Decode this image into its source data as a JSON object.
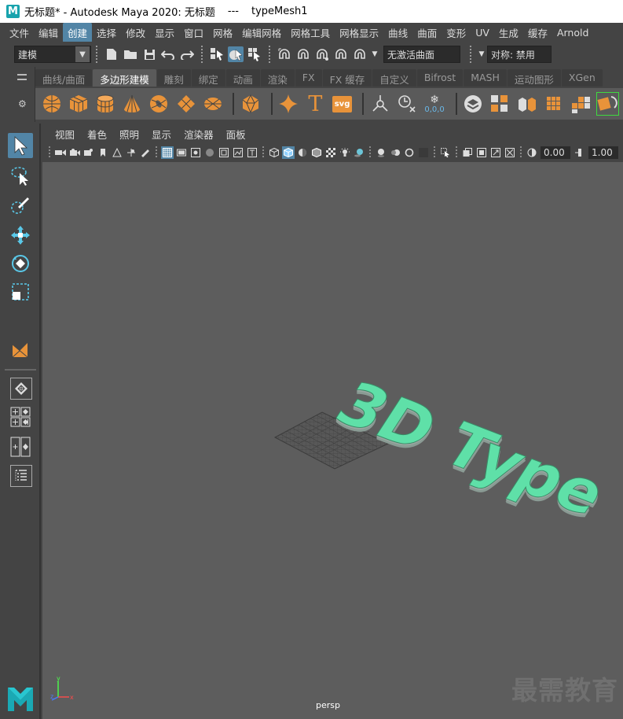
{
  "window": {
    "title": "无标题* - Autodesk Maya 2020: 无标题",
    "separator": "---",
    "object": "typeMesh1"
  },
  "menubar": {
    "items": [
      "文件",
      "编辑",
      "创建",
      "选择",
      "修改",
      "显示",
      "窗口",
      "网格",
      "编辑网格",
      "网格工具",
      "网格显示",
      "曲线",
      "曲面",
      "变形",
      "UV",
      "生成",
      "缓存",
      "Arnold"
    ],
    "active_index": 2
  },
  "statusline": {
    "menuset": "建模",
    "live_surface": "无激活曲面",
    "symmetry": "对称: 禁用"
  },
  "shelf": {
    "tabs": [
      "曲线/曲面",
      "多边形建模",
      "雕刻",
      "绑定",
      "动画",
      "渲染",
      "FX",
      "FX 缓存",
      "自定义",
      "Bifrost",
      "MASH",
      "运动图形",
      "XGen"
    ],
    "active_index": 1,
    "svg_label": "svg",
    "text_tool_label": "T",
    "snap_label": "0,0,0"
  },
  "panel": {
    "menus": [
      "视图",
      "着色",
      "照明",
      "显示",
      "渲染器",
      "面板"
    ],
    "exposure": "0.00",
    "gamma": "1.00"
  },
  "viewport": {
    "camera": "persp",
    "text_3d": "3D Type",
    "text_color": "#5fe0a8",
    "axis_y": "y",
    "axis_z": "z",
    "axis_x": "x"
  },
  "watermark": "最需教育",
  "colors": {
    "highlight": "#5285a6",
    "shelf_icon": "#e8933a",
    "viewport_bg": "#5d5d5d"
  }
}
